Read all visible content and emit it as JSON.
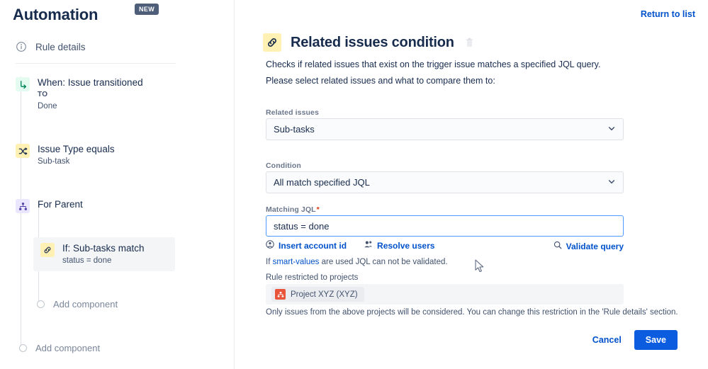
{
  "sidebar": {
    "title": "Automation",
    "badge": "NEW",
    "rule_details": "Rule details",
    "rule_details_icon": "info-circle-icon",
    "nodes": [
      {
        "icon": "trigger-transition-icon",
        "title": "When: Issue transitioned",
        "sub_caps": "TO",
        "sub": "Done"
      },
      {
        "icon": "shuffle-icon",
        "title": "Issue Type equals",
        "sub": "Sub-task"
      },
      {
        "icon": "hierarchy-icon",
        "title": "For Parent",
        "sub": ""
      }
    ],
    "selected_node": {
      "icon": "link-chain-icon",
      "title": "If: Sub-tasks match",
      "sub": "status = done"
    },
    "add_component_inner": "Add component",
    "add_component_outer": "Add component"
  },
  "header": {
    "return_link": "Return to list"
  },
  "main": {
    "icon": "link-chain-icon",
    "title": "Related issues condition",
    "delete_icon": "trash-icon",
    "description_1": "Checks if related issues that exist on the trigger issue matches a specified JQL query.",
    "description_2": "Please select related issues and what to compare them to:",
    "related_issues": {
      "label": "Related issues",
      "value": "Sub-tasks",
      "chevron": "chevron-down-icon"
    },
    "condition": {
      "label": "Condition",
      "value": "All match specified JQL",
      "chevron": "chevron-down-icon"
    },
    "matching_jql": {
      "label": "Matching JQL",
      "required_marker": "*",
      "value": "status = done",
      "placeholder": "Enter JQL"
    },
    "jql_actions": {
      "insert_account_id": "Insert account id",
      "insert_account_id_icon": "person-circle-icon",
      "resolve_users": "Resolve users",
      "resolve_users_icon": "people-icon",
      "validate_query": "Validate query",
      "validate_query_icon": "search-icon"
    },
    "hint_prefix": "If ",
    "hint_link": "smart-values",
    "hint_suffix": " are used JQL can not be validated.",
    "restricted": {
      "label": "Rule restricted to projects",
      "chip_label": "Project XYZ (XYZ)",
      "chip_icon": "project-avatar-icon",
      "note": "Only issues from the above projects will be considered. You can change this restriction in the 'Rule details' section."
    },
    "footer": {
      "cancel": "Cancel",
      "save": "Save"
    }
  },
  "colors": {
    "link": "#0052cc",
    "primary_button": "#0c5ce0",
    "badge_bg": "#4e5d78",
    "accent_yellow": "#fff0b3",
    "accent_green": "#e3fcef",
    "accent_purple": "#eae6ff",
    "required_red": "#de350b",
    "project_avatar": "#e8553b"
  }
}
